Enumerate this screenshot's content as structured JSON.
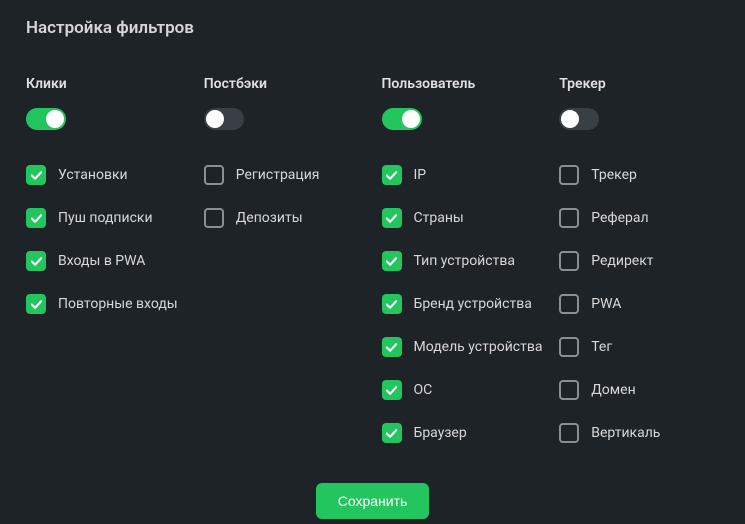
{
  "title": "Настройка фильтров",
  "columns": {
    "clicks": {
      "header": "Клики",
      "toggle": true,
      "items": [
        {
          "label": "Установки",
          "checked": true
        },
        {
          "label": "Пуш подписки",
          "checked": true
        },
        {
          "label": "Входы в PWA",
          "checked": true
        },
        {
          "label": "Повторные входы",
          "checked": true
        }
      ]
    },
    "postbacks": {
      "header": "Постбэки",
      "toggle": false,
      "items": [
        {
          "label": "Регистрация",
          "checked": false
        },
        {
          "label": "Депозиты",
          "checked": false
        }
      ]
    },
    "user": {
      "header": "Пользователь",
      "toggle": true,
      "items": [
        {
          "label": "IP",
          "checked": true
        },
        {
          "label": "Страны",
          "checked": true
        },
        {
          "label": "Тип устройства",
          "checked": true
        },
        {
          "label": "Бренд устройства",
          "checked": true
        },
        {
          "label": "Модель устройства",
          "checked": true
        },
        {
          "label": "ОС",
          "checked": true
        },
        {
          "label": "Браузер",
          "checked": true
        }
      ]
    },
    "tracker": {
      "header": "Трекер",
      "toggle": false,
      "items": [
        {
          "label": "Трекер",
          "checked": false
        },
        {
          "label": "Реферал",
          "checked": false
        },
        {
          "label": "Редирект",
          "checked": false
        },
        {
          "label": "PWA",
          "checked": false
        },
        {
          "label": "Тег",
          "checked": false
        },
        {
          "label": "Домен",
          "checked": false
        },
        {
          "label": "Вертикаль",
          "checked": false
        }
      ]
    }
  },
  "save_label": "Сохранить",
  "colors": {
    "accent": "#22c55e",
    "background": "#1e2328"
  }
}
